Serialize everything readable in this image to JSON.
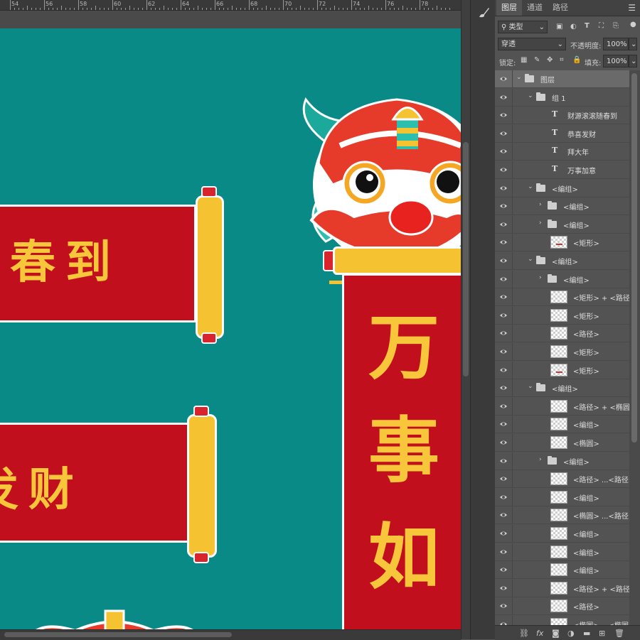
{
  "ruler": {
    "labels": [
      "54",
      "56",
      "58",
      "60",
      "62",
      "64",
      "66",
      "68",
      "70",
      "72",
      "74",
      "76",
      "78"
    ]
  },
  "canvas": {
    "bg_color": "#0a8a87",
    "banner_top_text": "春到",
    "banner_mid_text": "发财",
    "banner_right_text": [
      "万",
      "事",
      "如"
    ]
  },
  "panel": {
    "tabs": [
      "图层",
      "通道",
      "路径"
    ],
    "filter_kind": "类型",
    "blend_mode": "穿透",
    "opacity_label": "不透明度:",
    "opacity_value": "100%",
    "lock_label": "锁定:",
    "fill_label": "填充:",
    "fill_value": "100%"
  },
  "layers": [
    {
      "name": "图层",
      "kind": "folder",
      "indent": 0,
      "open": true,
      "selected": true
    },
    {
      "name": "组 1",
      "kind": "folder",
      "indent": 1,
      "open": true
    },
    {
      "name": "财源滚滚随春到",
      "kind": "text",
      "indent": 2
    },
    {
      "name": "恭喜发财",
      "kind": "text",
      "indent": 2
    },
    {
      "name": "拜大年",
      "kind": "text",
      "indent": 2
    },
    {
      "name": "万事加意",
      "kind": "text",
      "indent": 2
    },
    {
      "name": "<编组>",
      "kind": "folder",
      "indent": 1,
      "open": true
    },
    {
      "name": "<编组>",
      "kind": "folder",
      "indent": 2,
      "open": false
    },
    {
      "name": "<编组>",
      "kind": "folder",
      "indent": 2,
      "open": false
    },
    {
      "name": "<矩形>",
      "kind": "thumb",
      "indent": 2,
      "mark": true
    },
    {
      "name": "<编组>",
      "kind": "folder",
      "indent": 1,
      "open": true
    },
    {
      "name": "<编组>",
      "kind": "folder",
      "indent": 2,
      "open": false
    },
    {
      "name": "<矩形> + <路径>",
      "kind": "thumb",
      "indent": 2
    },
    {
      "name": "<矩形>",
      "kind": "thumb",
      "indent": 2
    },
    {
      "name": "<路径>",
      "kind": "thumb",
      "indent": 2
    },
    {
      "name": "<矩形>",
      "kind": "thumb",
      "indent": 2
    },
    {
      "name": "<矩形>",
      "kind": "thumb",
      "indent": 2,
      "mark": true
    },
    {
      "name": "<编组>",
      "kind": "folder",
      "indent": 1,
      "open": true
    },
    {
      "name": "<路径> + <椭圆>",
      "kind": "thumb",
      "indent": 2
    },
    {
      "name": "<编组>",
      "kind": "thumb",
      "indent": 2
    },
    {
      "name": "<椭圆>",
      "kind": "thumb",
      "indent": 2
    },
    {
      "name": "<编组>",
      "kind": "folder",
      "indent": 2,
      "open": false
    },
    {
      "name": "<路径> ...<路径>",
      "kind": "thumb",
      "indent": 2
    },
    {
      "name": "<编组>",
      "kind": "thumb",
      "indent": 2
    },
    {
      "name": "<椭圆> ...<路径>",
      "kind": "thumb",
      "indent": 2
    },
    {
      "name": "<编组>",
      "kind": "thumb",
      "indent": 2
    },
    {
      "name": "<编组>",
      "kind": "thumb",
      "indent": 2
    },
    {
      "name": "<编组>",
      "kind": "thumb",
      "indent": 2
    },
    {
      "name": "<路径> + <路径>",
      "kind": "thumb",
      "indent": 2
    },
    {
      "name": "<路径>",
      "kind": "thumb",
      "indent": 2
    },
    {
      "name": "<椭圆> ...<椭圆>",
      "kind": "thumb",
      "indent": 2
    },
    {
      "name": "<编组>",
      "kind": "thumb",
      "indent": 2
    }
  ],
  "bottom_icons": [
    "link-icon",
    "fx-icon",
    "mask-icon",
    "adjustment-icon",
    "new-group-icon",
    "new-layer-icon",
    "delete-icon"
  ]
}
